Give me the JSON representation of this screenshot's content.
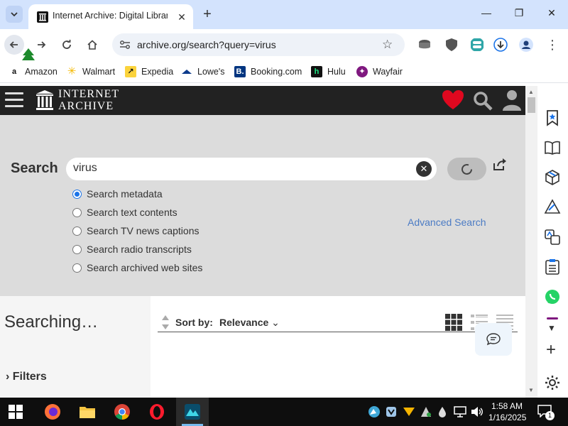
{
  "browser": {
    "tab_title": "Internet Archive: Digital Library",
    "url": "archive.org/search?query=virus",
    "bookmarks": [
      "Amazon",
      "Walmart",
      "Expedia",
      "Lowe's",
      "Booking.com",
      "Hulu",
      "Wayfair"
    ]
  },
  "ia": {
    "wordmark_line1": "INTERNET",
    "wordmark_line2": "ARCHIVE",
    "search_label": "Search",
    "search_value": "virus",
    "options": [
      {
        "label": "Search metadata",
        "checked": true
      },
      {
        "label": "Search text contents",
        "checked": false
      },
      {
        "label": "Search TV news captions",
        "checked": false
      },
      {
        "label": "Search radio transcripts",
        "checked": false
      },
      {
        "label": "Search archived web sites",
        "checked": false
      }
    ],
    "advanced_search": "Advanced Search",
    "status": "Searching…",
    "sort_label": "Sort by:",
    "sort_value": "Relevance",
    "filters_label": "Filters"
  },
  "taskbar": {
    "time": "1:58 AM",
    "date": "1/16/2025",
    "notification_count": "1"
  },
  "icons": [
    "search-tabs-icon",
    "archive-logo-icon",
    "close-icon",
    "plus-icon",
    "minimize-icon",
    "restore-icon",
    "back-icon",
    "forward-icon",
    "reload-icon",
    "home-icon",
    "site-info-icon",
    "star-icon",
    "heart-icon",
    "search-icon",
    "user-icon",
    "share-icon",
    "grid-view-icon",
    "list-view-icon",
    "compact-list-icon",
    "chat-icon",
    "gear-icon",
    "windows-start-icon"
  ]
}
